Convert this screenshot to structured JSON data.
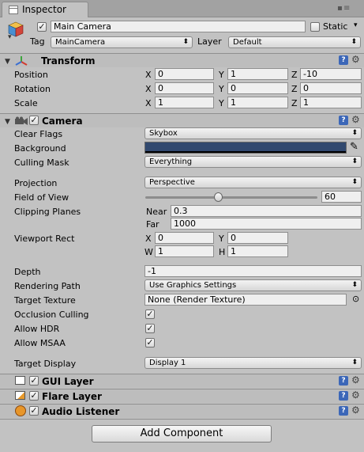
{
  "window": {
    "tab_label": "Inspector",
    "menu_icon": "window-menu-icon"
  },
  "object": {
    "active": true,
    "name": "Main Camera",
    "static_label": "Static",
    "static_checked": false,
    "tag_label": "Tag",
    "tag_value": "MainCamera",
    "layer_label": "Layer",
    "layer_value": "Default"
  },
  "transform": {
    "title": "Transform",
    "rows": [
      {
        "label": "Position",
        "x": "0",
        "y": "1",
        "z": "-10"
      },
      {
        "label": "Rotation",
        "x": "0",
        "y": "0",
        "z": "0"
      },
      {
        "label": "Scale",
        "x": "1",
        "y": "1",
        "z": "1"
      }
    ],
    "axes": {
      "x": "X",
      "y": "Y",
      "z": "Z"
    }
  },
  "camera": {
    "title": "Camera",
    "enabled": true,
    "clear_flags": {
      "label": "Clear Flags",
      "value": "Skybox"
    },
    "background": {
      "label": "Background",
      "color": "#31496f"
    },
    "culling_mask": {
      "label": "Culling Mask",
      "value": "Everything"
    },
    "projection": {
      "label": "Projection",
      "value": "Perspective"
    },
    "fov": {
      "label": "Field of View",
      "value": "60",
      "fraction": 0.42
    },
    "clipping": {
      "label": "Clipping Planes",
      "near_label": "Near",
      "near": "0.3",
      "far_label": "Far",
      "far": "1000"
    },
    "viewport": {
      "label": "Viewport Rect",
      "x_label": "X",
      "x": "0",
      "y_label": "Y",
      "y": "0",
      "w_label": "W",
      "w": "1",
      "h_label": "H",
      "h": "1"
    },
    "depth": {
      "label": "Depth",
      "value": "-1"
    },
    "rendering_path": {
      "label": "Rendering Path",
      "value": "Use Graphics Settings"
    },
    "target_texture": {
      "label": "Target Texture",
      "value": "None (Render Texture)"
    },
    "occlusion_culling": {
      "label": "Occlusion Culling",
      "checked": true
    },
    "allow_hdr": {
      "label": "Allow HDR",
      "checked": true
    },
    "allow_msaa": {
      "label": "Allow MSAA",
      "checked": true
    },
    "target_display": {
      "label": "Target Display",
      "value": "Display 1"
    }
  },
  "components": [
    {
      "title": "GUI Layer"
    },
    {
      "title": "Flare Layer"
    },
    {
      "title": "Audio Listener"
    }
  ],
  "add_component_label": "Add Component",
  "icons": {
    "help": "?",
    "gear": "⚙",
    "check": "✓",
    "arrow_down": "▾",
    "arrow_both": "⬍",
    "foldout_open": "▼"
  }
}
